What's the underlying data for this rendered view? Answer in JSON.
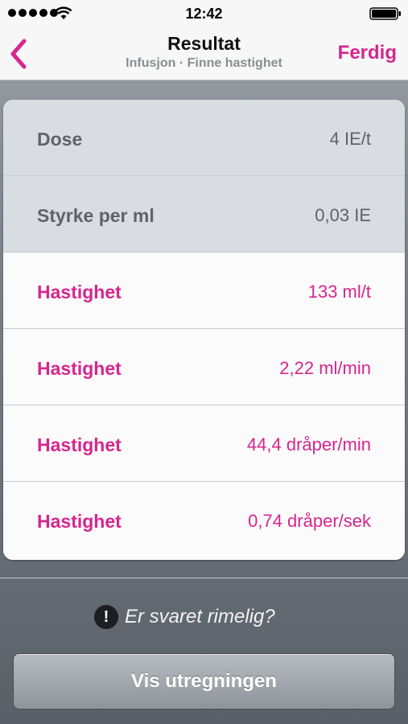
{
  "status_bar": {
    "time": "12:42",
    "signal_icon": "signal-dots-icon",
    "wifi_icon": "wifi-icon",
    "battery_icon": "battery-icon"
  },
  "nav": {
    "back_icon": "chevron-left-icon",
    "title": "Resultat",
    "subtitle": "Infusjon · Finne hastighet",
    "done_label": "Ferdig"
  },
  "colors": {
    "accent": "#d6268f",
    "input_row_bg": "#d9dde1",
    "result_row_bg": "#fbfbfb"
  },
  "inputs": [
    {
      "label": "Dose",
      "value": "4 IE/t"
    },
    {
      "label": "Styrke per ml",
      "value": "0,03 IE"
    }
  ],
  "results": [
    {
      "label": "Hastighet",
      "value": "133 ml/t"
    },
    {
      "label": "Hastighet",
      "value": "2,22 ml/min"
    },
    {
      "label": "Hastighet",
      "value": "44,4 dråper/min"
    },
    {
      "label": "Hastighet",
      "value": "0,74 dråper/sek"
    }
  ],
  "hint": {
    "icon": "exclamation-icon",
    "icon_glyph": "!",
    "text": "Er svaret rimelig?"
  },
  "show_button_label": "Vis utregningen"
}
